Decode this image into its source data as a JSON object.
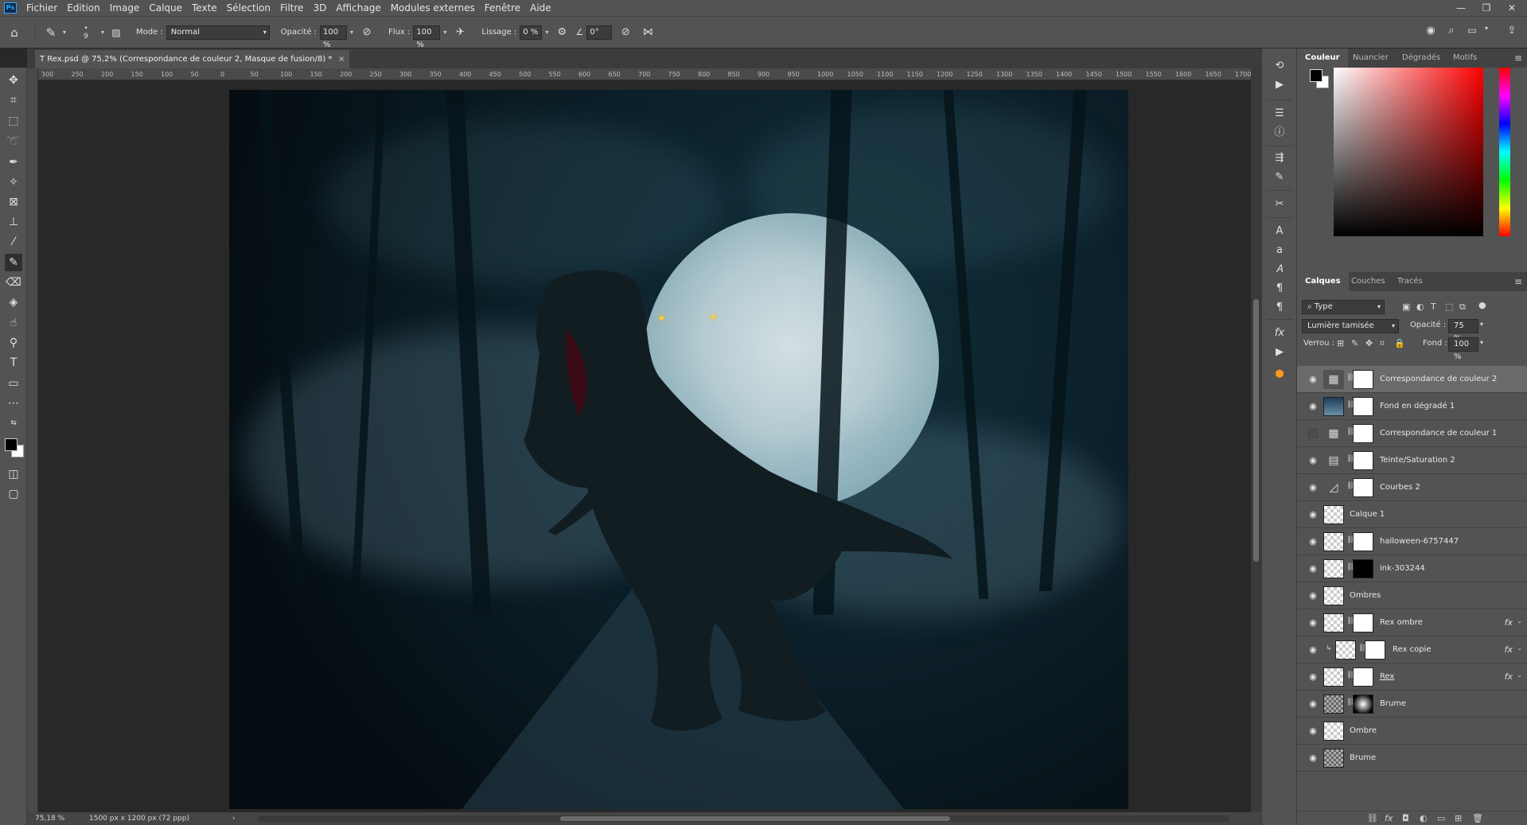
{
  "app": {
    "logo": "Ps"
  },
  "menu": [
    "Fichier",
    "Edition",
    "Image",
    "Calque",
    "Texte",
    "Sélection",
    "Filtre",
    "3D",
    "Affichage",
    "Modules externes",
    "Fenêtre",
    "Aide"
  ],
  "window_controls": {
    "minimize": "—",
    "maximize": "❐",
    "close": "✕"
  },
  "options": {
    "brush_size": "9",
    "mode_label": "Mode :",
    "mode_value": "Normal",
    "opacity_label": "Opacité :",
    "opacity_value": "100 %",
    "flow_label": "Flux :",
    "flow_value": "100 %",
    "smoothing_label": "Lissage :",
    "smoothing_value": "0 %",
    "angle_value": "0°"
  },
  "document": {
    "tab_title": "T Rex.psd @ 75,2% (Correspondance de couleur 2, Masque de fusion/8) *",
    "tab_close": "×"
  },
  "ruler_ticks": [
    "300",
    "250",
    "200",
    "150",
    "100",
    "50",
    "0",
    "50",
    "100",
    "150",
    "200",
    "250",
    "300",
    "350",
    "400",
    "450",
    "500",
    "550",
    "600",
    "650",
    "700",
    "750",
    "800",
    "850",
    "900",
    "950",
    "1000",
    "1050",
    "1100",
    "1150",
    "1200",
    "1250",
    "1300",
    "1350",
    "1400",
    "1450",
    "1500",
    "1550",
    "1600",
    "1650",
    "1700"
  ],
  "status": {
    "zoom": "75,18 %",
    "doc_info": "1500 px x 1200 px (72 ppp)",
    "arrow": "›"
  },
  "color_panel": {
    "tabs": [
      "Couleur",
      "Nuancier",
      "Dégradés",
      "Motifs"
    ],
    "active_tab": "Couleur"
  },
  "layers_panel": {
    "tabs": [
      "Calques",
      "Couches",
      "Tracés"
    ],
    "filter_value": "Type",
    "blend_mode": "Lumière tamisée",
    "opacity_label": "Opacité :",
    "opacity_value": "75 %",
    "lock_label": "Verrou :",
    "fill_label": "Fond :",
    "fill_value": "100 %",
    "layers": [
      {
        "name": "Correspondance de couleur 2",
        "visible": true,
        "selected": true
      },
      {
        "name": "Fond en dégradé 1",
        "visible": true
      },
      {
        "name": "Correspondance de couleur 1",
        "visible": false
      },
      {
        "name": "Teinte/Saturation 2",
        "visible": true
      },
      {
        "name": "Courbes 2",
        "visible": true
      },
      {
        "name": "Calque 1",
        "visible": true
      },
      {
        "name": "halloween-6757447",
        "visible": true
      },
      {
        "name": "ink-303244",
        "visible": true
      },
      {
        "name": "Ombres",
        "visible": true
      },
      {
        "name": "Rex ombre",
        "visible": true,
        "fx": "fx"
      },
      {
        "name": "Rex copie",
        "visible": true,
        "fx": "fx"
      },
      {
        "name": "Rex",
        "visible": true,
        "fx": "fx"
      },
      {
        "name": "Brume",
        "visible": true
      },
      {
        "name": "Ombre",
        "visible": true
      },
      {
        "name": "Brume",
        "visible": true
      }
    ]
  },
  "icons": {
    "eye": "👁",
    "link": "⛓",
    "fx_arrow": "⌄"
  }
}
